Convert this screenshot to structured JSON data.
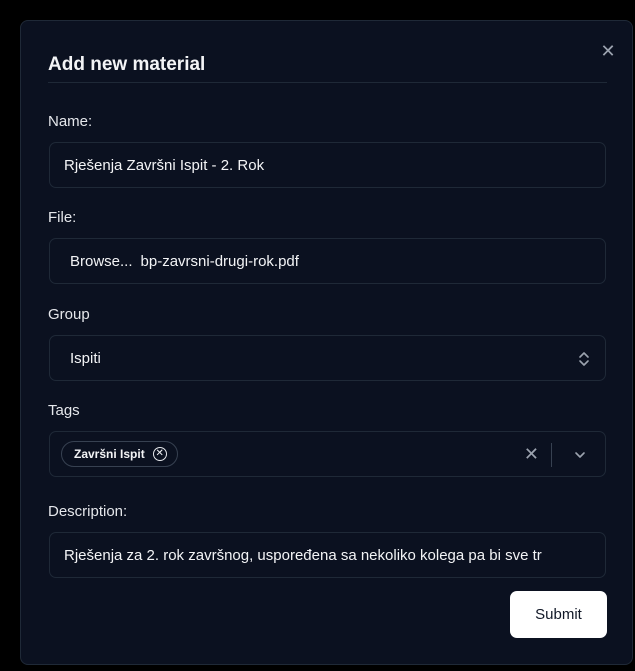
{
  "modal": {
    "title": "Add new material",
    "close_icon": "close-icon"
  },
  "form": {
    "name": {
      "label": "Name:",
      "value": "Rješenja Završni Ispit - 2. Rok"
    },
    "file": {
      "label": "File:",
      "browse_label": "Browse...",
      "file_name": "bp-zavrsni-drugi-rok.pdf"
    },
    "group": {
      "label": "Group",
      "selected": "Ispiti",
      "icon": "chevron-up-down-icon"
    },
    "tags": {
      "label": "Tags",
      "items": [
        {
          "label": "Završni Ispit",
          "remove_icon": "circle-x-icon"
        }
      ],
      "clear_icon": "close-icon",
      "dropdown_icon": "chevron-down-icon"
    },
    "description": {
      "label": "Description:",
      "value": "Rješenja za 2. rok završnog, uspoređena sa nekoliko kolega pa bi sve tr"
    },
    "submit_label": "Submit"
  },
  "colors": {
    "background": "#000000",
    "modal_bg": "#0b1120",
    "border": "#1f2937",
    "text": "#e5e7eb",
    "button_bg": "#ffffff",
    "button_text": "#111827"
  }
}
